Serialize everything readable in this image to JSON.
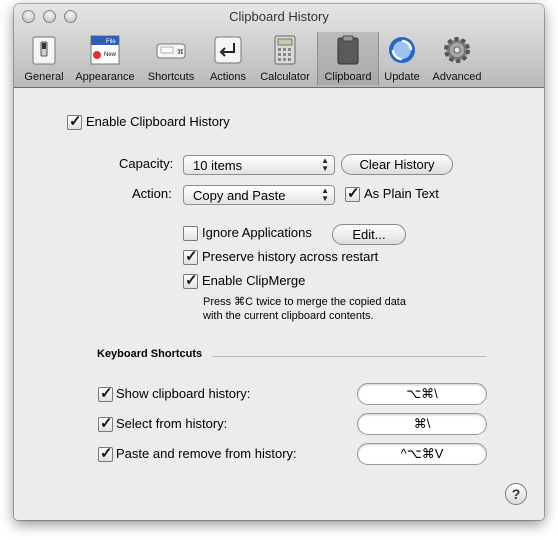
{
  "window": {
    "title": "Clipboard History"
  },
  "toolbar": {
    "items": [
      {
        "label": "General",
        "icon": "switch-icon"
      },
      {
        "label": "Appearance",
        "icon": "appearance-icon",
        "menu_file": "File",
        "menu_new": "New"
      },
      {
        "label": "Shortcuts",
        "icon": "keyboard-icon"
      },
      {
        "label": "Actions",
        "icon": "return-arrow-icon"
      },
      {
        "label": "Calculator",
        "icon": "calculator-icon"
      },
      {
        "label": "Clipboard",
        "icon": "clipboard-icon",
        "selected": true
      },
      {
        "label": "Update",
        "icon": "update-globe-icon"
      },
      {
        "label": "Advanced",
        "icon": "gear-icon"
      }
    ]
  },
  "settings": {
    "enable_history": {
      "label": "Enable Clipboard History",
      "checked": true
    },
    "capacity": {
      "label": "Capacity:",
      "value": "10 items"
    },
    "clear_history": {
      "label": "Clear History"
    },
    "action": {
      "label": "Action:",
      "value": "Copy and Paste"
    },
    "plain_text": {
      "label": "As Plain Text",
      "checked": true
    },
    "ignore_apps": {
      "label": "Ignore Applications",
      "checked": false
    },
    "edit_button": {
      "label": "Edit..."
    },
    "preserve": {
      "label": "Preserve history across restart",
      "checked": true
    },
    "clipmerge": {
      "label": "Enable ClipMerge",
      "checked": true
    },
    "clipmerge_desc_1": "Press ⌘C twice to merge the copied data",
    "clipmerge_desc_2": "with the current clipboard contents."
  },
  "shortcuts": {
    "heading": "Keyboard Shortcuts",
    "items": [
      {
        "label": "Show clipboard history:",
        "keys": "⌥⌘\\",
        "checked": true
      },
      {
        "label": "Select from history:",
        "keys": "⌘\\",
        "checked": true
      },
      {
        "label": "Paste and remove from history:",
        "keys": "^⌥⌘V",
        "checked": true
      }
    ]
  },
  "help": {
    "label": "?"
  },
  "check_mark": "✓"
}
